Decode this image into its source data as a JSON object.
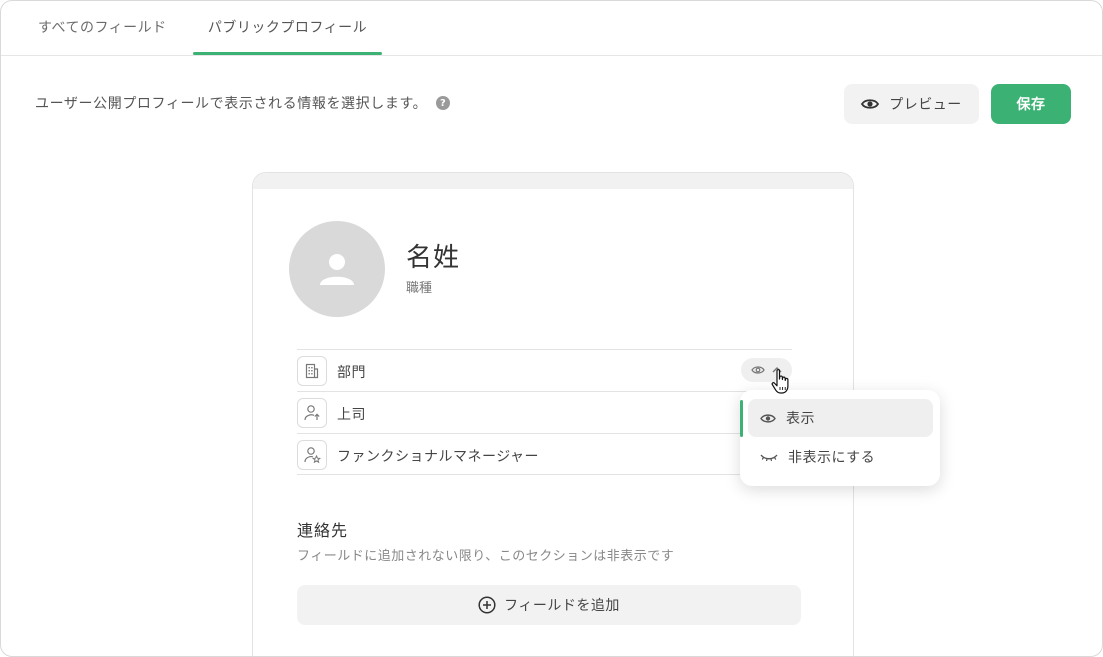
{
  "tabs": [
    {
      "label": "すべてのフィールド"
    },
    {
      "label": "パブリックプロフィール"
    }
  ],
  "header": {
    "description": "ユーザー公開プロフィールで表示される情報を選択します。",
    "help_icon": "question-circle-icon",
    "preview_label": "プレビュー",
    "save_label": "保存"
  },
  "profile": {
    "name": "名姓",
    "job_title": "職種",
    "fields": [
      {
        "label": "部門",
        "icon": "building-icon"
      },
      {
        "label": "上司",
        "icon": "user-up-icon"
      },
      {
        "label": "ファンクショナルマネージャー",
        "icon": "user-star-icon"
      }
    ]
  },
  "contacts": {
    "title": "連絡先",
    "subtitle": "フィールドに追加されない限り、このセクションは非表示です",
    "add_label": "フィールドを追加"
  },
  "visibility_menu": {
    "options": [
      {
        "label": "表示",
        "icon": "eye-icon",
        "selected": true
      },
      {
        "label": "非表示にする",
        "icon": "eye-closed-icon",
        "selected": false
      }
    ]
  },
  "colors": {
    "accent": "#3bb273",
    "muted_bg": "#f2f2f2",
    "avatar_bg": "#d9d9d9"
  }
}
